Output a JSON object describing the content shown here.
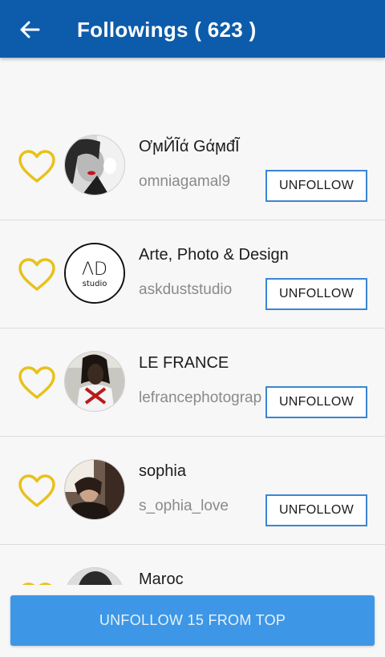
{
  "header": {
    "title": "Followings ( 623 )",
    "back_icon": "arrow-left-icon",
    "background": "#0d5cab"
  },
  "accent": {
    "heart": "#e8c11a",
    "button_border": "#3a86d4",
    "bottom_button": "#3d97e6"
  },
  "followings": [
    {
      "name": "ƠϻЙĨά GάϻđĨ",
      "username": "omniagamal9",
      "button": "UNFOLLOW",
      "avatar": "portrait-photo"
    },
    {
      "name": "Arte, Photo & Design",
      "username": "askduststudio",
      "button": "UNFOLLOW",
      "avatar": "ad-studio-logo",
      "logo_text": "ΛD",
      "logo_sub": "studio"
    },
    {
      "name": "LE FRANCE",
      "username": "lefrancephotograp",
      "button": "UNFOLLOW",
      "avatar": "portrait-photo"
    },
    {
      "name": "sophia",
      "username": "s_ophia_love",
      "button": "UNFOLLOW",
      "avatar": "portrait-photo"
    },
    {
      "name": "Maroc",
      "username": "",
      "button": "",
      "avatar": "portrait-photo"
    }
  ],
  "bottom_action": {
    "label": "UNFOLLOW 15 FROM TOP"
  }
}
